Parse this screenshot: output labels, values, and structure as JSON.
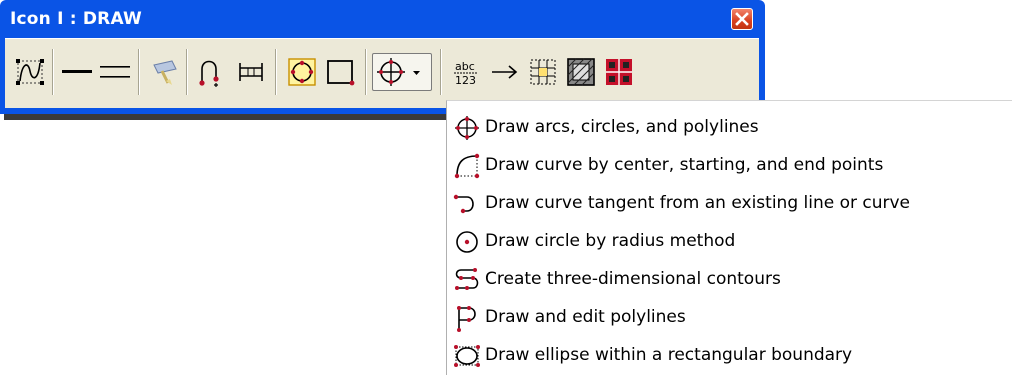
{
  "window": {
    "title": "Icon I : DRAW",
    "close_icon": "close-icon"
  },
  "toolbar": {
    "tools": [
      {
        "name": "spline-tool",
        "icon": "spline-icon"
      },
      {
        "name": "single-line-tool",
        "icon": "single-line-icon"
      },
      {
        "name": "double-line-tool",
        "icon": "double-line-icon"
      },
      {
        "name": "sweep-tool",
        "icon": "sweep-icon"
      },
      {
        "name": "curve-point-tool",
        "icon": "curve-point-icon"
      },
      {
        "name": "dimension-tool",
        "icon": "dimension-icon"
      },
      {
        "name": "circle-in-square-tool",
        "icon": "circle-in-square-icon"
      },
      {
        "name": "rectangle-tool",
        "icon": "rectangle-icon"
      },
      {
        "name": "arc-menu-tool",
        "icon": "arc-circle-polyline-icon"
      },
      {
        "name": "text-tool",
        "icon": "text-icon"
      },
      {
        "name": "arrow-tool",
        "icon": "arrow-icon"
      },
      {
        "name": "grid-text-tool",
        "icon": "grid-text-icon"
      },
      {
        "name": "hatch-tool",
        "icon": "hatch-icon"
      },
      {
        "name": "pattern-tool",
        "icon": "pattern-icon"
      }
    ]
  },
  "menu": {
    "items": [
      {
        "label": "Draw arcs, circles, and polylines",
        "icon": "arc-circle-polyline-icon"
      },
      {
        "label": "Draw curve by center, starting, and end points",
        "icon": "curve-center-icon"
      },
      {
        "label": "Draw curve tangent from an existing line or curve",
        "icon": "tangent-curve-icon"
      },
      {
        "label": "Draw circle by radius method",
        "icon": "circle-radius-icon"
      },
      {
        "label": "Create three-dimensional contours",
        "icon": "contour-icon"
      },
      {
        "label": "Draw and edit polylines",
        "icon": "polyline-icon"
      },
      {
        "label": "Draw ellipse within a rectangular boundary",
        "icon": "ellipse-boundary-icon"
      }
    ]
  },
  "colors": {
    "titlebar": "#0a54e6",
    "toolbar_bg": "#ece9d8",
    "node_red": "#b8102a",
    "menu_bg": "#ffffff"
  }
}
